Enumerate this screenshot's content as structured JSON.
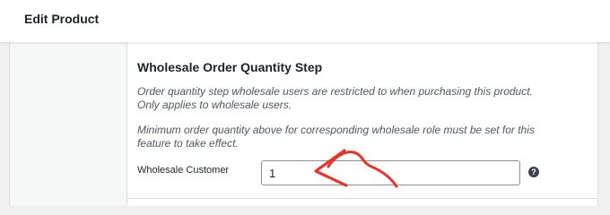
{
  "header": {
    "title": "Edit Product"
  },
  "section": {
    "title": "Wholesale Order Quantity Step",
    "description_1_line_1": "Order quantity step wholesale users are restricted to when purchasing this product.",
    "description_1_line_2": "Only applies to wholesale users.",
    "description_2_line_1": "Minimum order quantity above for corresponding wholesale role must be set for this",
    "description_2_line_2": "feature to take effect."
  },
  "field": {
    "label": "Wholesale Customer",
    "value": "1",
    "help_icon": "question-circle-icon",
    "help_glyph": "?"
  },
  "annotation": {
    "arrow_color": "#e8352b"
  },
  "colors": {
    "background": "#f0f0f1",
    "panel": "#ffffff",
    "text": "#1d2327",
    "muted_text": "#50575e"
  }
}
